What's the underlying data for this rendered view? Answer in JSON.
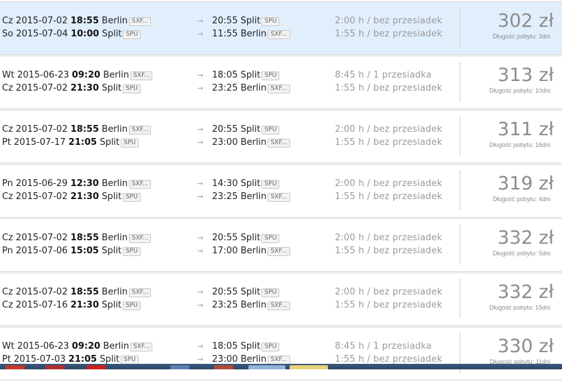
{
  "results": [
    {
      "selected": true,
      "outbound": {
        "day": "Cz",
        "date": "2015-07-02",
        "time": "18:55",
        "from": "Berlin",
        "from_code": "SXF...",
        "arr_time": "20:55",
        "to": "Split",
        "to_code": "SPU",
        "duration": "2:00 h / bez przesiadek"
      },
      "inbound": {
        "day": "So",
        "date": "2015-07-04",
        "time": "10:00",
        "from": "Split",
        "from_code": "SPU",
        "arr_time": "11:55",
        "to": "Berlin",
        "to_code": "SXF...",
        "duration": "1:55 h / bez przesiadek"
      },
      "price": "302 zł",
      "stay": "Długość pobytu: 3dni"
    },
    {
      "selected": false,
      "outbound": {
        "day": "Wt",
        "date": "2015-06-23",
        "time": "09:20",
        "from": "Berlin",
        "from_code": "SXF...",
        "arr_time": "18:05",
        "to": "Split",
        "to_code": "SPU",
        "duration": "8:45 h / 1 przesiadka"
      },
      "inbound": {
        "day": "Cz",
        "date": "2015-07-02",
        "time": "21:30",
        "from": "Split",
        "from_code": "SPU",
        "arr_time": "23:25",
        "to": "Berlin",
        "to_code": "SXF...",
        "duration": "1:55 h / bez przesiadek"
      },
      "price": "313 zł",
      "stay": "Długość pobytu: 10dni"
    },
    {
      "selected": false,
      "outbound": {
        "day": "Cz",
        "date": "2015-07-02",
        "time": "18:55",
        "from": "Berlin",
        "from_code": "SXF...",
        "arr_time": "20:55",
        "to": "Split",
        "to_code": "SPU",
        "duration": "2:00 h / bez przesiadek"
      },
      "inbound": {
        "day": "Pt",
        "date": "2015-07-17",
        "time": "21:05",
        "from": "Split",
        "from_code": "SPU",
        "arr_time": "23:00",
        "to": "Berlin",
        "to_code": "SXF...",
        "duration": "1:55 h / bez przesiadek"
      },
      "price": "311 zł",
      "stay": "Długość pobytu: 16dni"
    },
    {
      "selected": false,
      "outbound": {
        "day": "Pn",
        "date": "2015-06-29",
        "time": "12:30",
        "from": "Berlin",
        "from_code": "SXF...",
        "arr_time": "14:30",
        "to": "Split",
        "to_code": "SPU",
        "duration": "2:00 h / bez przesiadek"
      },
      "inbound": {
        "day": "Cz",
        "date": "2015-07-02",
        "time": "21:30",
        "from": "Split",
        "from_code": "SPU",
        "arr_time": "23:25",
        "to": "Berlin",
        "to_code": "SXF...",
        "duration": "1:55 h / bez przesiadek"
      },
      "price": "319 zł",
      "stay": "Długość pobytu: 4dni"
    },
    {
      "selected": false,
      "outbound": {
        "day": "Cz",
        "date": "2015-07-02",
        "time": "18:55",
        "from": "Berlin",
        "from_code": "SXF...",
        "arr_time": "20:55",
        "to": "Split",
        "to_code": "SPU",
        "duration": "2:00 h / bez przesiadek"
      },
      "inbound": {
        "day": "Pn",
        "date": "2015-07-06",
        "time": "15:05",
        "from": "Split",
        "from_code": "SPU",
        "arr_time": "17:00",
        "to": "Berlin",
        "to_code": "SXF...",
        "duration": "1:55 h / bez przesiadek"
      },
      "price": "332 zł",
      "stay": "Długość pobytu: 5dni"
    },
    {
      "selected": false,
      "outbound": {
        "day": "Cz",
        "date": "2015-07-02",
        "time": "18:55",
        "from": "Berlin",
        "from_code": "SXF...",
        "arr_time": "20:55",
        "to": "Split",
        "to_code": "SPU",
        "duration": "2:00 h / bez przesiadek"
      },
      "inbound": {
        "day": "Cz",
        "date": "2015-07-16",
        "time": "21:30",
        "from": "Split",
        "from_code": "SPU",
        "arr_time": "23:25",
        "to": "Berlin",
        "to_code": "SXF...",
        "duration": "1:55 h / bez przesiadek"
      },
      "price": "332 zł",
      "stay": "Długość pobytu: 15dni"
    },
    {
      "selected": false,
      "outbound": {
        "day": "Wt",
        "date": "2015-06-23",
        "time": "09:20",
        "from": "Berlin",
        "from_code": "SXF...",
        "arr_time": "18:05",
        "to": "Split",
        "to_code": "SPU",
        "duration": "8:45 h / 1 przesiadka"
      },
      "inbound": {
        "day": "Pt",
        "date": "2015-07-03",
        "time": "21:05",
        "from": "Split",
        "from_code": "SPU",
        "arr_time": "23:00",
        "to": "Berlin",
        "to_code": "SXF...",
        "duration": "1:55 h / bez przesiadek"
      },
      "price": "330 zł",
      "stay": "Długość pobytu: 11dni"
    }
  ],
  "icons": {
    "arrow": "→"
  },
  "colors": {
    "selected_bg": "#e1effd",
    "price": "#8c8c8c",
    "muted": "#9a9a9a"
  }
}
